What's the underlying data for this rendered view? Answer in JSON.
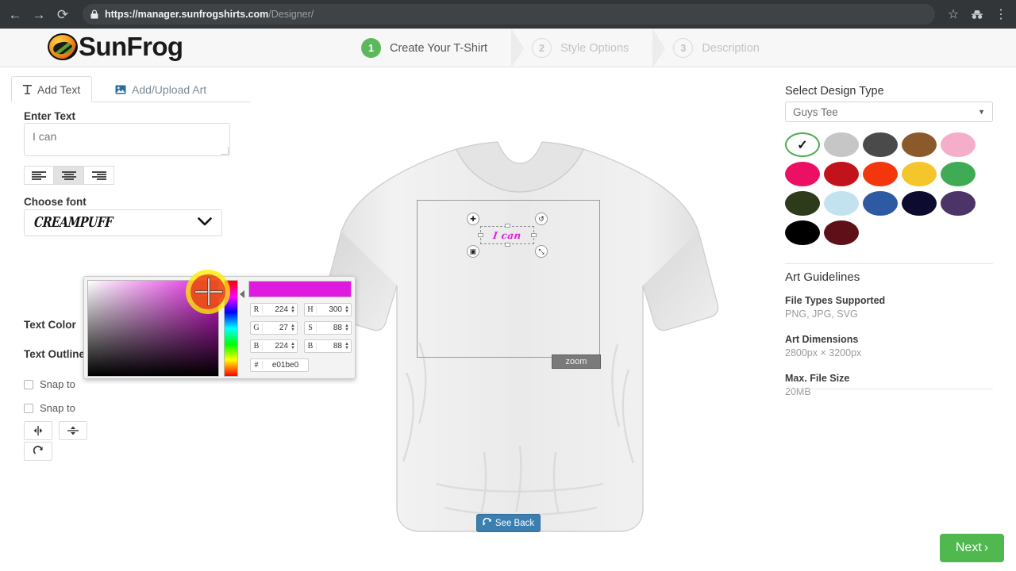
{
  "browser": {
    "back_icon": "back-arrow-icon",
    "forward_icon": "forward-arrow-icon",
    "reload_icon": "reload-icon",
    "lock_icon": "lock-icon",
    "url_secure": "https://manager.sunfrogshirts.com",
    "url_path": "/Designer/",
    "bookmark_icon": "star-icon",
    "profile_icon": "incognito-icon",
    "menu_icon": "three-dot-menu-icon"
  },
  "header": {
    "brand": "SunFrog",
    "steps": [
      {
        "num": "1",
        "label": "Create Your T-Shirt",
        "state": "active"
      },
      {
        "num": "2",
        "label": "Style Options",
        "state": "inactive"
      },
      {
        "num": "3",
        "label": "Description",
        "state": "inactive"
      }
    ]
  },
  "left_panel": {
    "tabs": [
      {
        "label": "Add Text",
        "icon": "text-tool-icon",
        "active": true
      },
      {
        "label": "Add/Upload Art",
        "icon": "image-upload-icon",
        "active": false
      }
    ],
    "enter_text_label": "Enter Text",
    "text_value": "I can",
    "text_placeholder": "I can",
    "align_buttons": [
      {
        "name": "align-left",
        "active": false
      },
      {
        "name": "align-center",
        "active": true
      },
      {
        "name": "align-right",
        "active": false
      }
    ],
    "font_label": "Choose font",
    "font_value": "CREAMPUFF",
    "text_color_label": "Text Color",
    "text_color_value": "#e01be0",
    "text_outline_label": "Text Outline",
    "snap_options": [
      {
        "label": "Snap to",
        "checked": false
      },
      {
        "label": "Snap to",
        "checked": false
      }
    ],
    "tool_buttons": [
      {
        "name": "center-horizontally-button",
        "glyph": "⇥⇤"
      },
      {
        "name": "center-vertically-button",
        "glyph": "⤓"
      },
      {
        "name": "reset-button",
        "glyph": "⟳"
      }
    ]
  },
  "color_picker": {
    "hex_label": "#",
    "hex_value": "e01be0",
    "preview_color": "#e01be0",
    "fields": [
      {
        "label": "R",
        "value": "224"
      },
      {
        "label": "G",
        "value": "27"
      },
      {
        "label": "B",
        "value": "224"
      },
      {
        "label": "H",
        "value": "300"
      },
      {
        "label": "S",
        "value": "88"
      },
      {
        "label": "B",
        "value": "88"
      }
    ]
  },
  "canvas": {
    "design_text": "I can",
    "design_text_color": "#e01be0",
    "zoom_button_label": "zoom",
    "see_back_label": "See Back",
    "see_back_icon": "refresh-icon",
    "handles": [
      {
        "name": "move-handle",
        "glyph": "✚"
      },
      {
        "name": "rotate-handle",
        "glyph": "↺"
      },
      {
        "name": "layer-handle",
        "glyph": "▣"
      },
      {
        "name": "resize-handle",
        "glyph": "⤡"
      }
    ]
  },
  "right_panel": {
    "design_type_label": "Select Design Type",
    "design_type_value": "Guys Tee",
    "dropdown_icon": "caret-down-icon",
    "swatches": [
      {
        "name": "white",
        "color": "#ffffff",
        "selected": true
      },
      {
        "name": "sport-grey",
        "color": "#c6c6c6",
        "selected": false
      },
      {
        "name": "charcoal",
        "color": "#4a4a4a",
        "selected": false
      },
      {
        "name": "brown",
        "color": "#8b5a2b",
        "selected": false
      },
      {
        "name": "light-pink",
        "color": "#f5aec9",
        "selected": false
      },
      {
        "name": "hot-pink",
        "color": "#ec1064",
        "selected": false
      },
      {
        "name": "cardinal-red",
        "color": "#c2121c",
        "selected": false
      },
      {
        "name": "orange",
        "color": "#f4360d",
        "selected": false
      },
      {
        "name": "gold",
        "color": "#f5c52c",
        "selected": false
      },
      {
        "name": "irish-green",
        "color": "#3fab54",
        "selected": false
      },
      {
        "name": "forest-green",
        "color": "#2e3b1a",
        "selected": false
      },
      {
        "name": "light-blue",
        "color": "#c3e2ef",
        "selected": false
      },
      {
        "name": "royal-blue",
        "color": "#2e5aa3",
        "selected": false
      },
      {
        "name": "navy",
        "color": "#0d0b2e",
        "selected": false
      },
      {
        "name": "purple",
        "color": "#4c3368",
        "selected": false
      },
      {
        "name": "black",
        "color": "#000000",
        "selected": false
      },
      {
        "name": "maroon",
        "color": "#5e1018",
        "selected": false
      }
    ],
    "guidelines": {
      "title": "Art Guidelines",
      "file_types_head": "File Types Supported",
      "file_types_value": "PNG, JPG, SVG",
      "dimensions_head": "Art Dimensions",
      "dimensions_value": "2800px  ×  3200px",
      "max_size_head": "Max. File Size",
      "max_size_value": "20MB"
    }
  },
  "footer": {
    "next_label": "Next",
    "next_chevron": "›"
  }
}
